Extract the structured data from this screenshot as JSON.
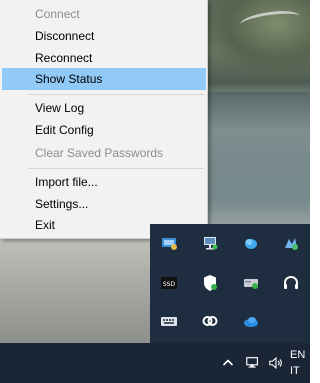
{
  "context_menu": {
    "items": [
      {
        "label": "Connect",
        "state": "disabled"
      },
      {
        "label": "Disconnect",
        "state": "enabled"
      },
      {
        "label": "Reconnect",
        "state": "enabled"
      },
      {
        "label": "Show Status",
        "state": "highlighted"
      },
      {
        "label": "View Log",
        "state": "enabled"
      },
      {
        "label": "Edit Config",
        "state": "enabled"
      },
      {
        "label": "Clear Saved Passwords",
        "state": "disabled"
      },
      {
        "label": "Import file...",
        "state": "enabled"
      },
      {
        "label": "Settings...",
        "state": "enabled"
      },
      {
        "label": "Exit",
        "state": "enabled"
      }
    ]
  },
  "tray_flyout": {
    "icons": [
      {
        "name": "network-adapter-icon"
      },
      {
        "name": "remote-display-icon"
      },
      {
        "name": "onedrive-cloud-icon"
      },
      {
        "name": "bluetooth-manager-icon"
      },
      {
        "name": "ssd-tool-icon",
        "text": "SSD"
      },
      {
        "name": "windows-security-icon"
      },
      {
        "name": "drive-sync-icon"
      },
      {
        "name": "headset-icon"
      },
      {
        "name": "keyboard-icon"
      },
      {
        "name": "link-icon"
      },
      {
        "name": "onedrive-icon"
      }
    ]
  },
  "taskbar": {
    "chevron_glyph": "^",
    "language_line1": "EN",
    "language_line2": "IT",
    "colors": {
      "background": "#1a2535",
      "flyout": "#1f2d40",
      "highlight": "#91c9f7"
    }
  }
}
